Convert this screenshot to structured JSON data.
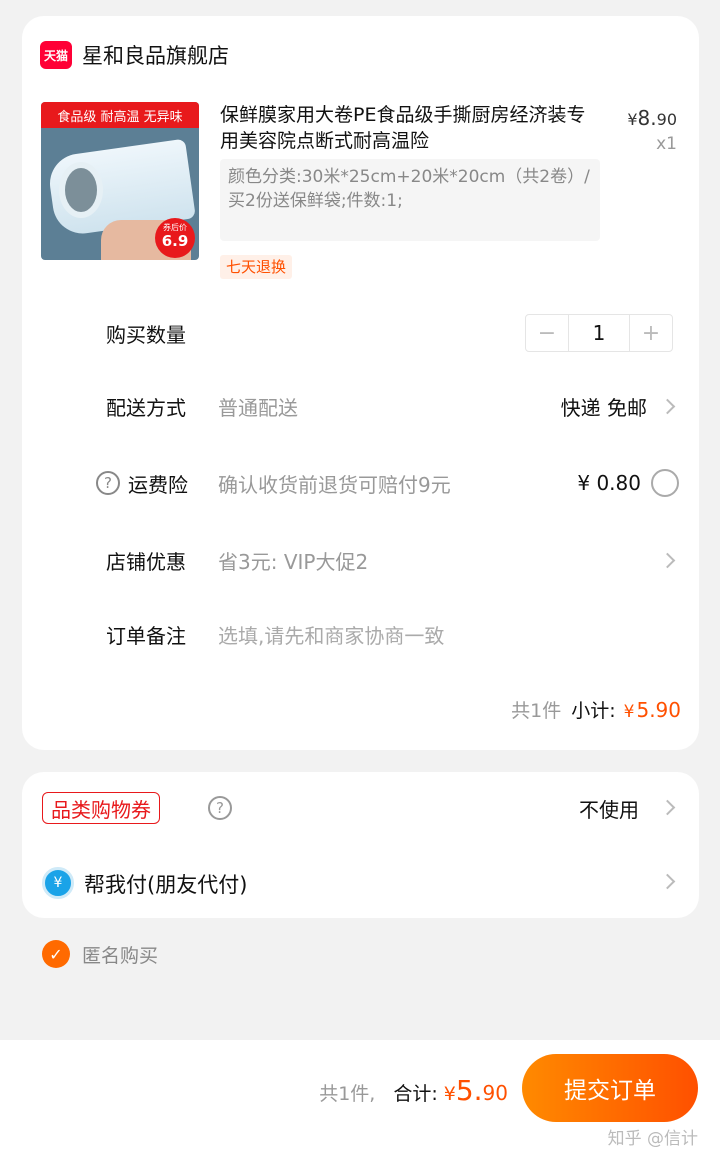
{
  "store": {
    "logo_text": "天猫",
    "name": "星和良品旗舰店"
  },
  "product": {
    "badge_tags": "食品级 耐高温 无异味",
    "badge_price_label": "券后价",
    "badge_price": "6.9",
    "title": "保鲜膜家用大卷PE食品级手撕厨房经济装专用美容院点断式耐高温险",
    "price_currency": "¥",
    "price_int": "8.",
    "price_dec": "90",
    "quantity_label": "x1",
    "sku": "颜色分类:30米*25cm+20米*20cm（共2卷）/买2份送保鲜袋;件数:1;",
    "return_tag": "七天退换"
  },
  "rows": {
    "quantity": {
      "label": "购买数量",
      "minus": "−",
      "value": "1",
      "plus": "+"
    },
    "delivery": {
      "label": "配送方式",
      "value": "普通配送",
      "right": "快递 免邮"
    },
    "shipping_insurance": {
      "help": "?",
      "label": "运费险",
      "value": "确认收货前退货可赔付9元",
      "right": "¥ 0.80"
    },
    "store_discount": {
      "label": "店铺优惠",
      "value": "省3元: VIP大促2"
    },
    "order_note": {
      "label": "订单备注",
      "placeholder": "选填,请先和商家协商一致"
    }
  },
  "subtotal": {
    "count": "共1件",
    "label": "小计:",
    "currency": "¥",
    "amount": "5.90"
  },
  "payment": {
    "coupon_label": "品类购物券",
    "coupon_help": "?",
    "coupon_value": "不使用",
    "friend_pay_icon": "¥",
    "friend_pay_label": "帮我付(朋友代付)"
  },
  "anonymous": {
    "check": "✓",
    "label": "匿名购买"
  },
  "footer": {
    "count": "共1件,",
    "total_label": "合计:",
    "currency": "¥",
    "total_int": "5.",
    "total_dec": "90",
    "submit_label": "提交订单",
    "watermark": "知乎 @信计"
  },
  "colors": {
    "accent": "#ff5000",
    "tmall_red": "#ff0036"
  }
}
